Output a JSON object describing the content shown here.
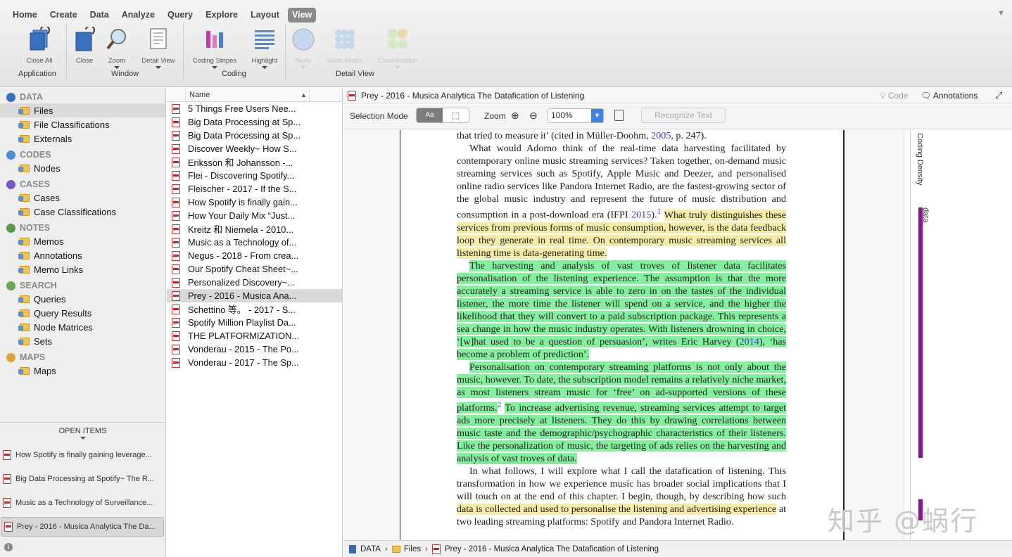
{
  "ribbon": {
    "menu": [
      "Home",
      "Create",
      "Data",
      "Analyze",
      "Query",
      "Explore",
      "Layout",
      "View"
    ],
    "active_menu": "View",
    "tools": {
      "close_all": "Close All",
      "close": "Close",
      "zoom": "Zoom",
      "detail_view": "Detail View",
      "coding_stripes": "Coding Stripes",
      "highlight": "Highlight",
      "node": "Node",
      "node_matrix": "Node Matrix",
      "classification": "Classification"
    },
    "groups": {
      "application": "Application",
      "window": "Window",
      "coding": "Coding",
      "detail_view": "Detail View"
    }
  },
  "nav": {
    "sections": [
      {
        "title": "DATA",
        "color": "#3b6fc4",
        "items": [
          "Files",
          "File Classifications",
          "Externals"
        ]
      },
      {
        "title": "CODES",
        "color": "#4a8fd8",
        "items": [
          "Nodes"
        ]
      },
      {
        "title": "CASES",
        "color": "#7a57c9",
        "items": [
          "Cases",
          "Case Classifications"
        ]
      },
      {
        "title": "NOTES",
        "color": "#5a9a4a",
        "items": [
          "Memos",
          "Annotations",
          "Memo Links"
        ]
      },
      {
        "title": "SEARCH",
        "color": "#6aa84f",
        "items": [
          "Queries",
          "Query Results",
          "Node Matrices",
          "Sets"
        ]
      },
      {
        "title": "MAPS",
        "color": "#e0a33a",
        "items": [
          "Maps"
        ]
      }
    ],
    "selected": "Files"
  },
  "open_items": {
    "title": "OPEN ITEMS",
    "items": [
      "How Spotify is finally gaining leverage...",
      "Big Data Processing at Spotify~ The R...",
      "Music as a Technology of Surveillance...",
      "Prey - 2016 - Musica Analytica The Da..."
    ],
    "selected_index": 3
  },
  "file_list": {
    "column_name": "Name",
    "files": [
      "5 Things Free Users Nee...",
      "Big Data Processing at Sp...",
      "Big Data Processing at Sp...",
      "Discover Weekly~ How S...",
      "Eriksson 和 Johansson -...",
      "Flei - Discovering Spotify...",
      "Fleischer - 2017 - If the S...",
      "How Spotify is finally gain...",
      "How Your Daily Mix “Just...",
      "Kreitz 和 Niemela - 2010...",
      "Music as a Technology of...",
      "Negus - 2018 - From crea...",
      "Our Spotify Cheat Sheet~...",
      "Personalized Discovery~...",
      "Prey - 2016 - Musica Ana...",
      "Schettino 等。 - 2017 - S...",
      "Spotify Million Playlist Da...",
      "THE PLATFORMIZATION...",
      "Vonderau - 2015 - The Po...",
      "Vonderau - 2017 - The Sp..."
    ],
    "selected_index": 14
  },
  "detail": {
    "title": "Prey - 2016 - Musica Analytica The Datafication of Listening",
    "code_label": "Code",
    "annotations_label": "Annotations",
    "selection_mode_label": "Selection Mode",
    "select_text_label": "Aa",
    "zoom_label": "Zoom",
    "zoom_value": "100%",
    "recognize_label": "Recognize Text",
    "coding_density_label": "Coding Density",
    "stripe_label": "data",
    "watermark": "知乎 @蜗行",
    "breadcrumb": [
      "DATA",
      "Files",
      "Prey - 2016 - Musica Analytica The Datafication of Listening"
    ],
    "text": {
      "p0": "that tried to measure it’ (cited in Müller-Doohm, ",
      "p0_ref": "2005",
      "p0_end": ", p. 247).",
      "p1_plain": "What would Adorno think of the real-time data harvesting facilitated by contemporary online music streaming services? Taken together, on-demand music streaming services such as Spotify, Apple Music and Deezer, and personalised online radio services like Pandora Internet Radio, are the fastest-growing sector of the global music industry and represent the future of music distribution and consumption in a post-download era (IFPI ",
      "p1_ref": "2015",
      "p1_after": ").",
      "p1_sup": "1",
      "p1_hl": "What truly distinguishes these services from previous forms of music consumption, however, is the data feedback loop they generate in real time. On contemporary music streaming services all listening time is data-generating time.",
      "p2_hl": "The harvesting and analysis of vast troves of listener data facilitates personalisation of the listening experience. The assumption is that the more accurately a streaming service is able to zero in on the tastes of the individual listener, the more time the listener will spend on a service, and the higher the likelihood that they will convert to a paid subscription package. This represents a sea change in how the music industry operates. With listeners drowning in choice, ‘[w]hat used to be a question of persuasion’, writes Eric Harvey (",
      "p2_ref": "2014",
      "p2_end": "), ‘has become a problem of prediction’.",
      "p3_hl": "Personalisation on contemporary streaming platforms is not only about the music, however. To date, the subscription model remains a relatively niche market, as most listeners stream music for ‘free’ on ad-supported versions of these platforms.",
      "p3_sup": "2",
      "p3_hl2": "To increase advertising revenue, streaming services attempt to target ads more precisely at listeners. They do this by drawing correlations between music taste and the demographic/psychographic characteristics of their listeners. Like the personalization of music, the targeting of ads relies on the harvesting and analysis of vast troves of data.",
      "p4_plain": "In what follows, I will explore what I call the datafication of listening. This transformation in how we experience music has broader social implications that I will touch on at the end of this chapter. I begin, though, by describing how such ",
      "p4_hl": "data is collected and used to personalise the listening and advertising experience",
      "p4_end": " at two leading streaming platforms: Spotify and Pandora Internet Radio."
    }
  }
}
